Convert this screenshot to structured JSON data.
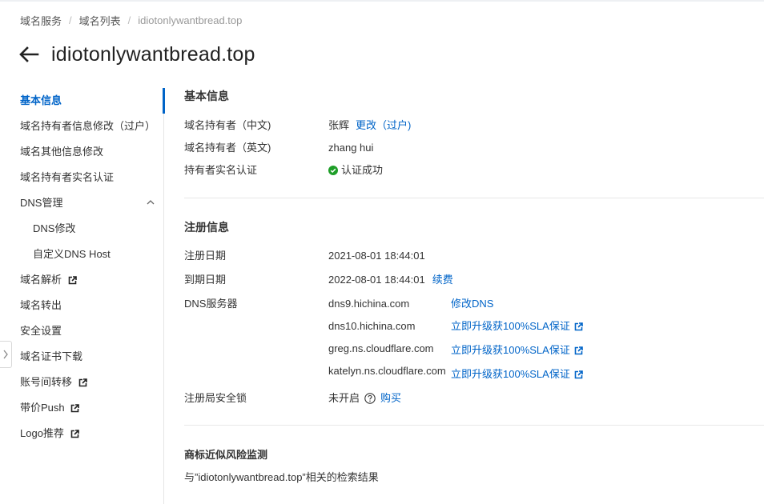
{
  "breadcrumb": {
    "items": [
      "域名服务",
      "域名列表"
    ],
    "current": "idiotonlywantbread.top"
  },
  "page": {
    "title": "idiotonlywantbread.top"
  },
  "sidebar": {
    "items": [
      {
        "label": "基本信息",
        "active": true
      },
      {
        "label": "域名持有者信息修改（过户）"
      },
      {
        "label": "域名其他信息修改"
      },
      {
        "label": "域名持有者实名认证"
      },
      {
        "label": "DNS管理",
        "expanded": true
      },
      {
        "label": "DNS修改",
        "sub": true
      },
      {
        "label": "自定义DNS Host",
        "sub": true
      },
      {
        "label": "域名解析",
        "external": true
      },
      {
        "label": "域名转出"
      },
      {
        "label": "安全设置"
      },
      {
        "label": "域名证书下载"
      },
      {
        "label": "账号间转移",
        "external": true
      },
      {
        "label": "带价Push",
        "external": true
      },
      {
        "label": "Logo推荐",
        "external": true
      }
    ]
  },
  "basic": {
    "title": "基本信息",
    "owner_cn_label": "域名持有者（中文)",
    "owner_cn_value": "张辉",
    "owner_cn_action": "更改（过户)",
    "owner_en_label": "域名持有者（英文)",
    "owner_en_value": "zhang hui",
    "verify_label": "持有者实名认证",
    "verify_value": "认证成功"
  },
  "registration": {
    "title": "注册信息",
    "reg_date_label": "注册日期",
    "reg_date_value": "2021-08-01 18:44:01",
    "exp_date_label": "到期日期",
    "exp_date_value": "2022-08-01 18:44:01",
    "renew_action": "续费",
    "dns_label": "DNS服务器",
    "dns_servers": [
      {
        "host": "dns9.hichina.com",
        "action": "修改DNS",
        "external": false
      },
      {
        "host": "dns10.hichina.com",
        "action": "立即升级获100%SLA保证",
        "external": true
      },
      {
        "host": "greg.ns.cloudflare.com",
        "action": "立即升级获100%SLA保证",
        "external": true
      },
      {
        "host": "katelyn.ns.cloudflare.com",
        "action": "立即升级获100%SLA保证",
        "external": true
      }
    ],
    "lock_label": "注册局安全锁",
    "lock_value": "未开启",
    "lock_action": "购买"
  },
  "trademark": {
    "title": "商标近似风险监测",
    "desc": "与”idiotonlywantbread.top”相关的检索结果"
  },
  "colors": {
    "accent": "#0064c8",
    "success": "#1e9e28",
    "text": "#333333"
  },
  "icons": [
    "back-arrow-icon",
    "external-link-icon",
    "chevron-up-icon",
    "check-circle-icon",
    "question-circle-icon",
    "chevron-right-icon"
  ]
}
